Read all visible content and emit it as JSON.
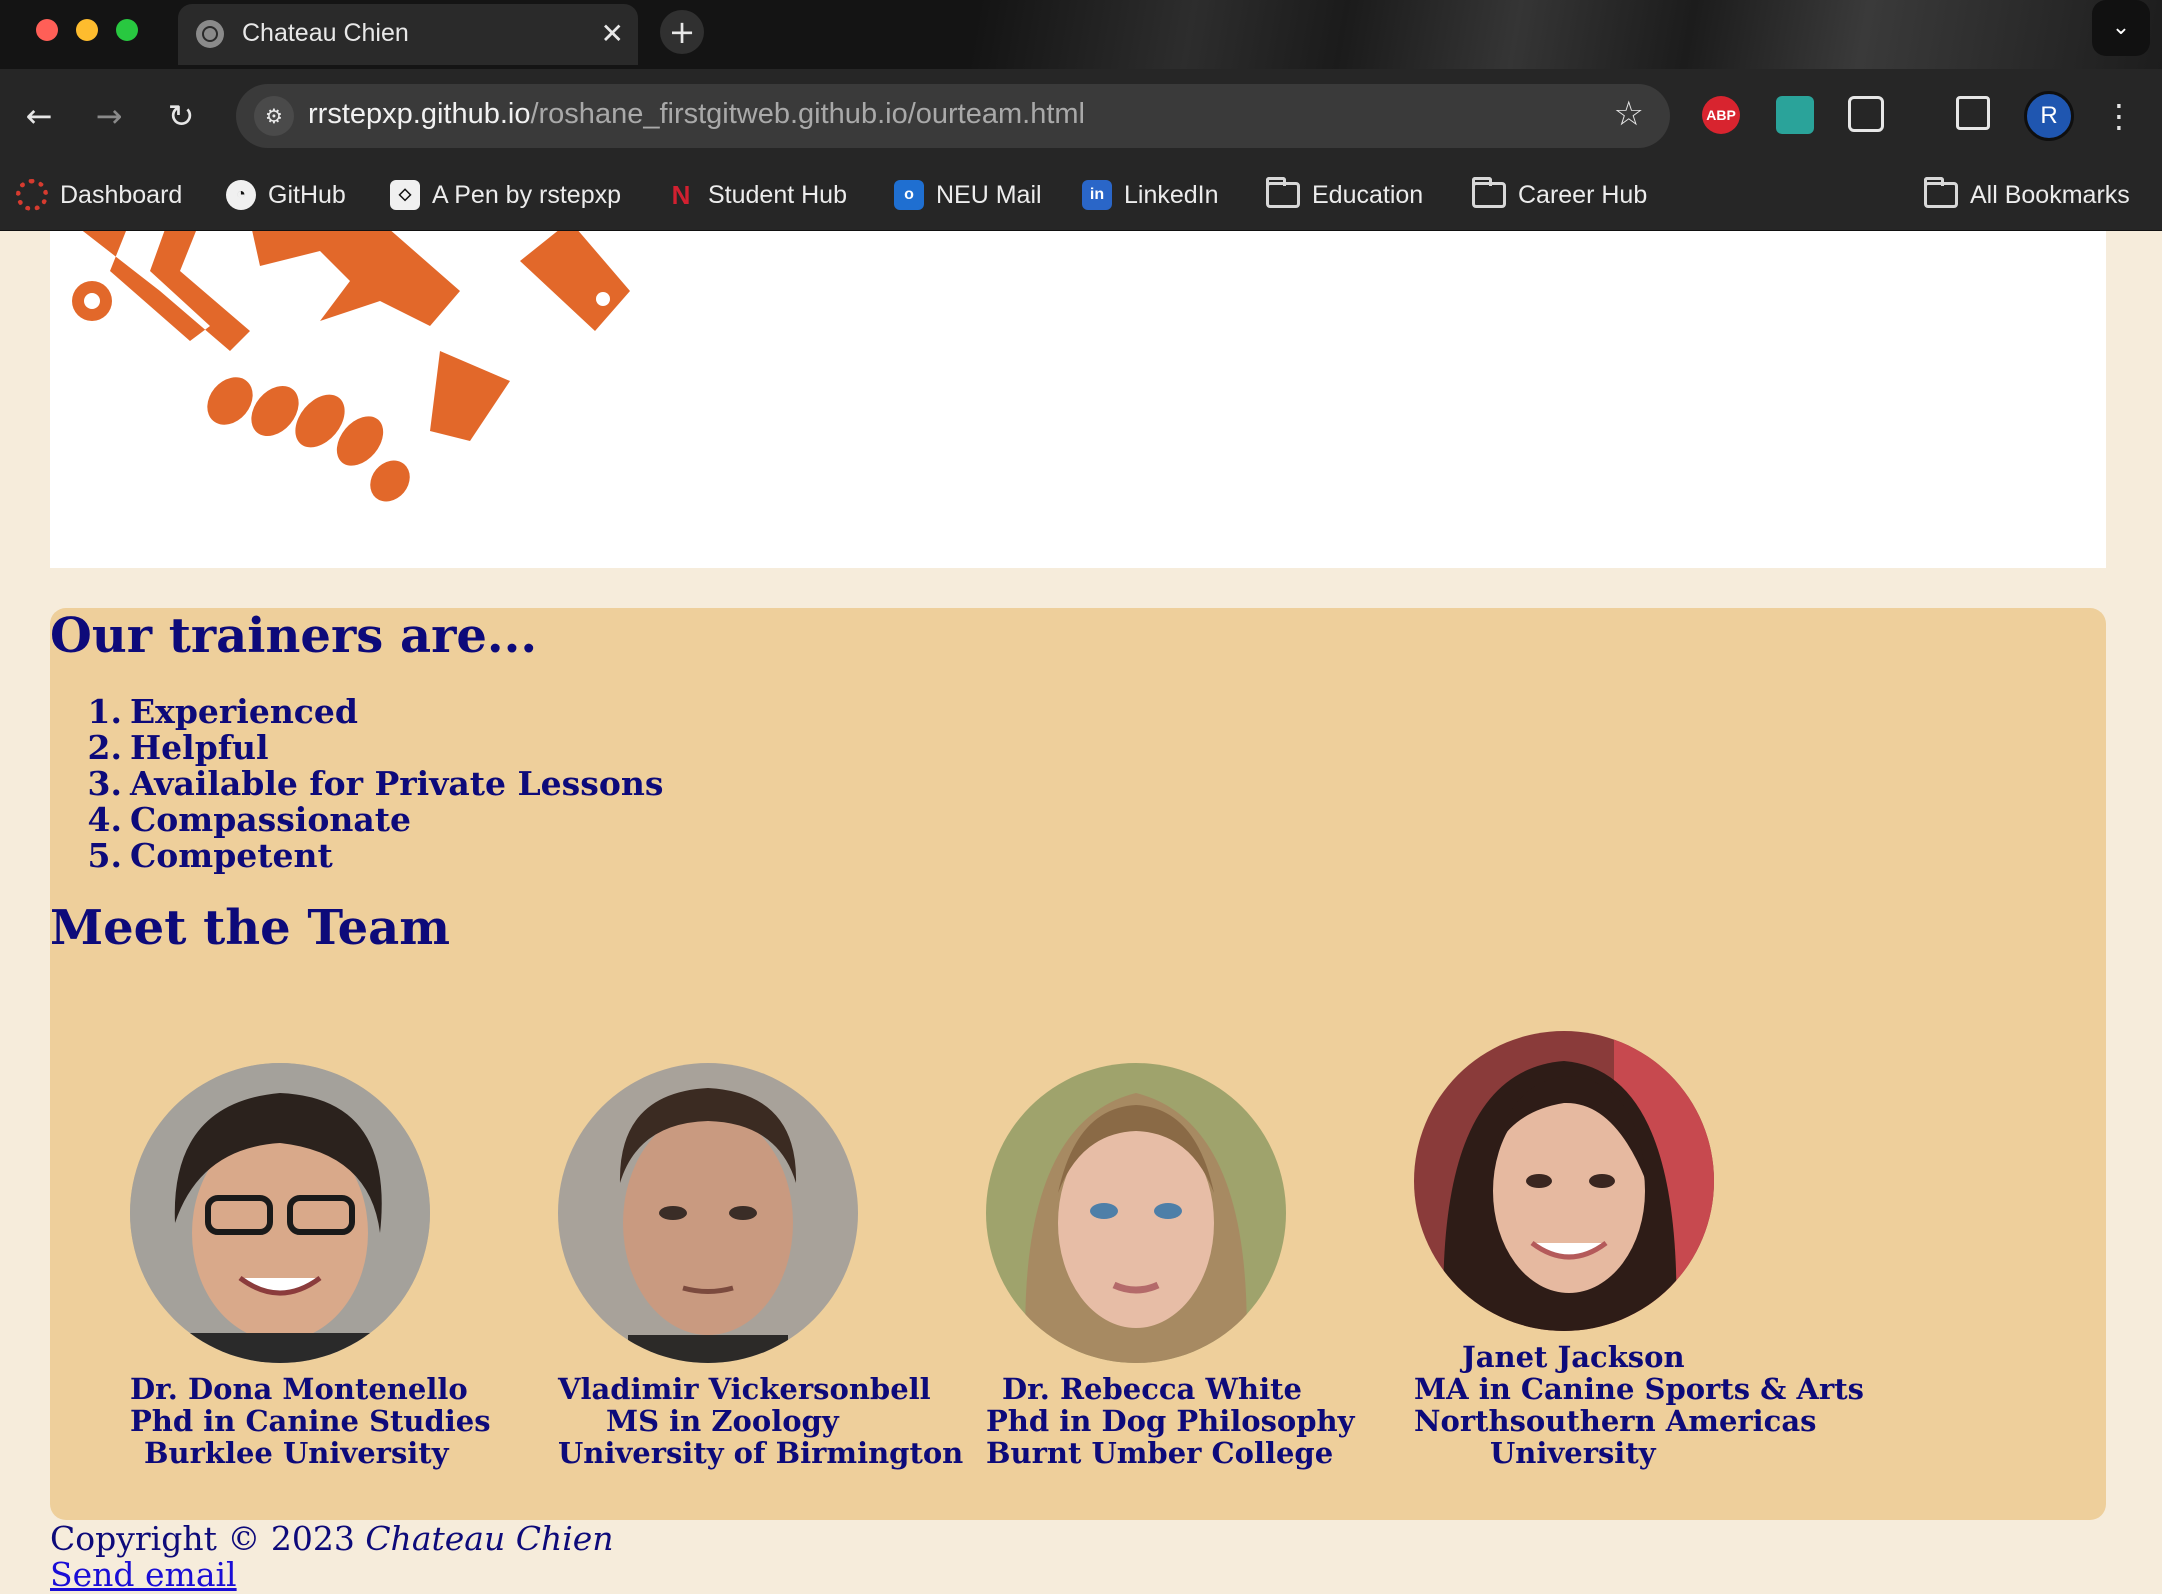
{
  "browser": {
    "tab_title": "Chateau Chien",
    "tab_close": "✕",
    "new_tab": "+",
    "url_host": "rrstepxp.github.io",
    "url_path": "/roshane_firstgitweb.github.io/ourteam.html",
    "avatar_initial": "R",
    "ext_abp": "ABP",
    "bookmarks": [
      {
        "label": "Dashboard",
        "icon": "canvas-icon"
      },
      {
        "label": "GitHub",
        "icon": "github-icon"
      },
      {
        "label": "A Pen by rstepxp",
        "icon": "codepen-icon"
      },
      {
        "label": "Student Hub",
        "icon": "neu-icon"
      },
      {
        "label": "NEU Mail",
        "icon": "outlook-icon"
      },
      {
        "label": "LinkedIn",
        "icon": "linkedin-icon"
      },
      {
        "label": "Education",
        "icon": "folder-icon"
      },
      {
        "label": "Career Hub",
        "icon": "folder-icon"
      }
    ],
    "all_bookmarks": "All Bookmarks"
  },
  "page": {
    "trainers_heading": "Our trainers are...",
    "traits": [
      "Experienced",
      "Helpful",
      "Available for Private Lessons",
      "Compassionate",
      "Competent"
    ],
    "team_heading": "Meet the Team",
    "team": [
      {
        "lines": [
          "Dr. Dona Montenello",
          "Phd in Canine Studies",
          "Burklee University"
        ]
      },
      {
        "lines": [
          "Vladimir Vickersonbell",
          "MS in Zoology",
          "University of Birmington"
        ]
      },
      {
        "lines": [
          "Dr. Rebecca White",
          "Phd in Dog Philosophy",
          "Burnt Umber College"
        ]
      },
      {
        "lines": [
          "Janet Jackson",
          "MA in Canine Sports & Arts",
          "Northsouthern Americas",
          "University"
        ]
      }
    ],
    "footer": {
      "copyright": "Copyright © 2023 ",
      "brand": "Chateau Chien",
      "email_link": "Send email"
    }
  },
  "colors": {
    "heading": "#0d0a7a",
    "content_bg": "#eecf9b",
    "page_bg": "#f6ecdb",
    "logo_orange": "#e2682a"
  }
}
